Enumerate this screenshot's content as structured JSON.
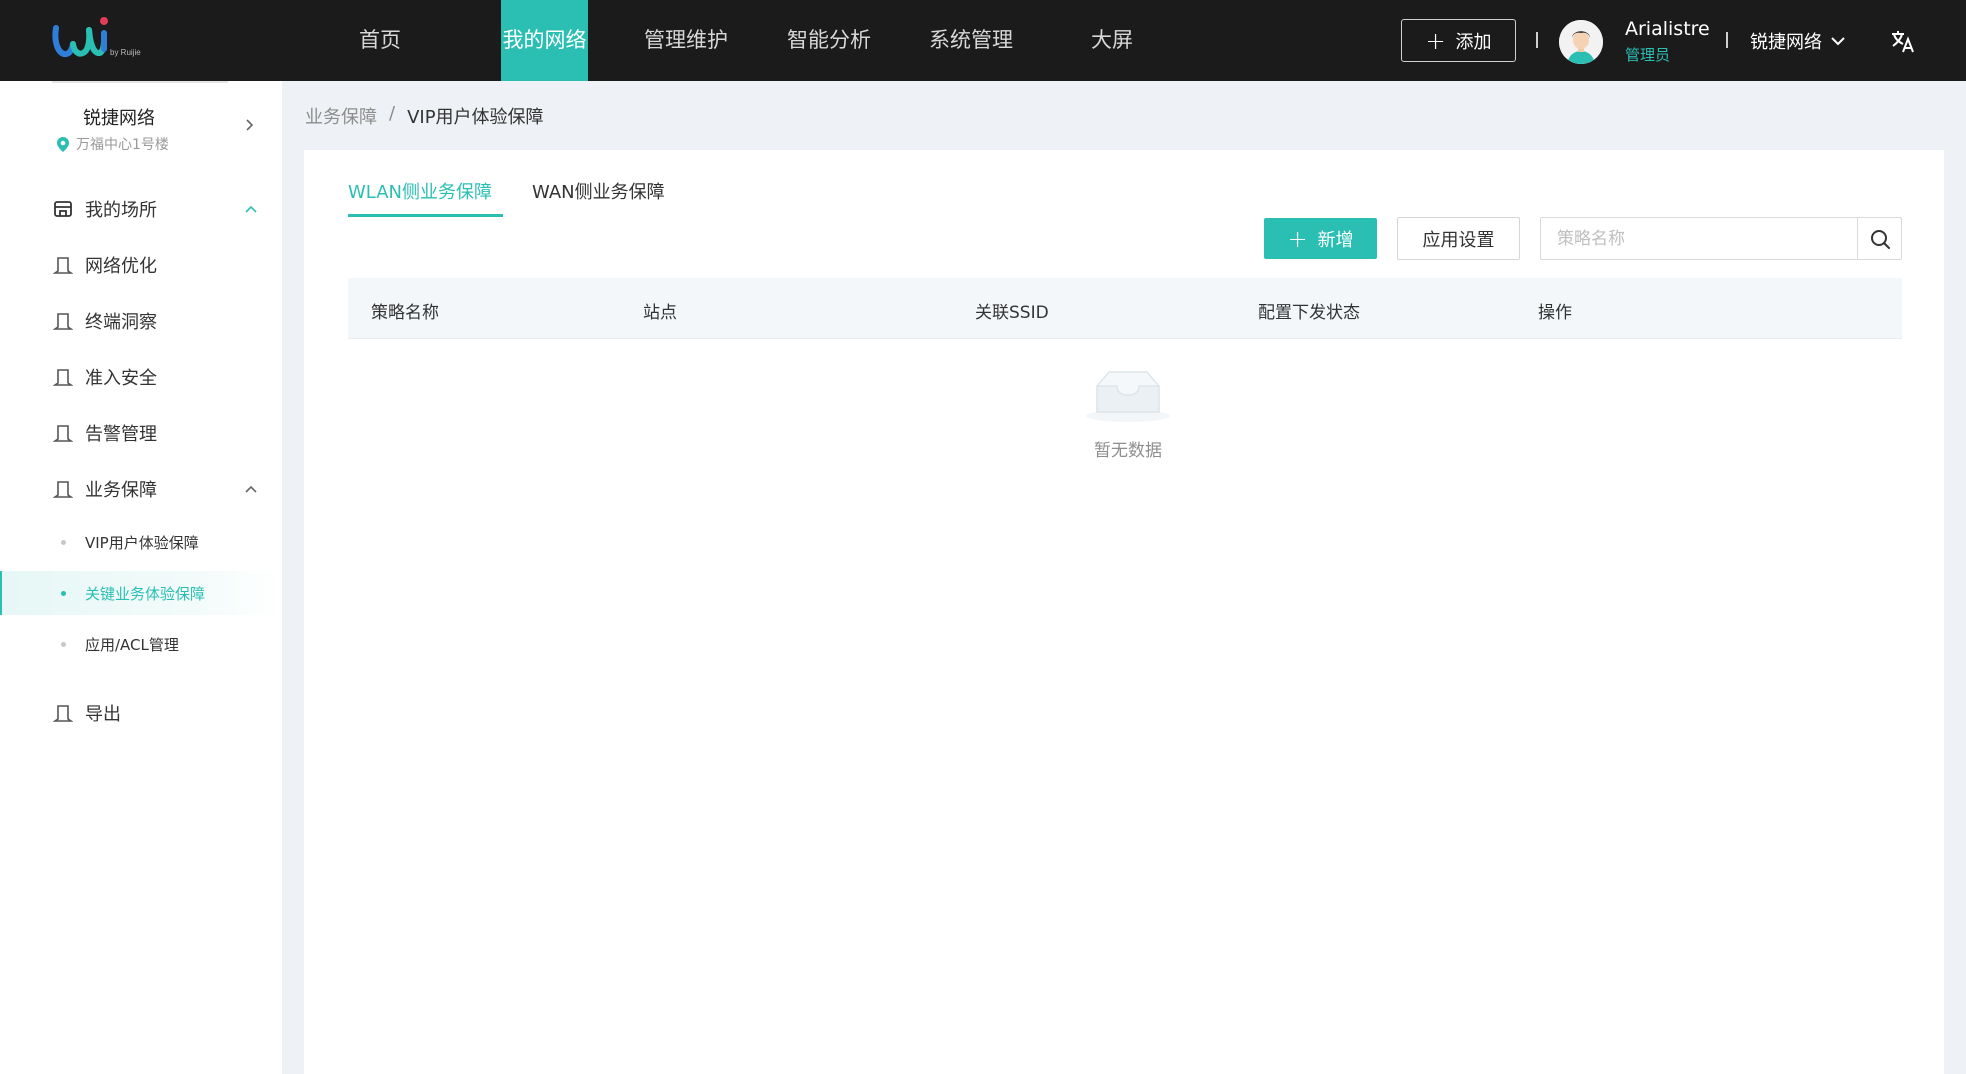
{
  "topbar": {
    "logo_text": "by Ruijie",
    "nav": [
      "首页",
      "我的网络",
      "管理维护",
      "智能分析",
      "系统管理",
      "大屏"
    ],
    "active_nav": "我的网络",
    "add_label": "添加",
    "user_name": "Arialistre",
    "user_role": "管理员",
    "org_name": "锐捷网络"
  },
  "sidebar": {
    "site_name": "锐捷网络",
    "site_location": "万福中心1号楼",
    "items": [
      {
        "label": "我的场所",
        "expanded": true
      },
      {
        "label": "网络优化"
      },
      {
        "label": "终端洞察"
      },
      {
        "label": "准入安全"
      },
      {
        "label": "告警管理"
      },
      {
        "label": "业务保障",
        "expanded": true
      },
      {
        "label": "导出"
      }
    ],
    "sub_items": [
      {
        "label": "VIP用户体验保障"
      },
      {
        "label": "关键业务体验保障",
        "active": true
      },
      {
        "label": "应用/ACL管理"
      }
    ]
  },
  "breadcrumb": {
    "parent": "业务保障",
    "separator": "/",
    "current": "VIP用户体验保障"
  },
  "main": {
    "tabs": [
      "WLAN侧业务保障",
      "WAN侧业务保障"
    ],
    "active_tab": "WLAN侧业务保障",
    "new_button": "新增",
    "settings_button": "应用设置",
    "search_placeholder": "策略名称",
    "columns": [
      "策略名称",
      "站点",
      "关联SSID",
      "配置下发状态",
      "操作"
    ],
    "empty_text": "暂无数据"
  },
  "colors": {
    "accent": "#2bbfb4",
    "topbar_bg": "#1b1b1b",
    "page_bg": "#eef1f5"
  }
}
